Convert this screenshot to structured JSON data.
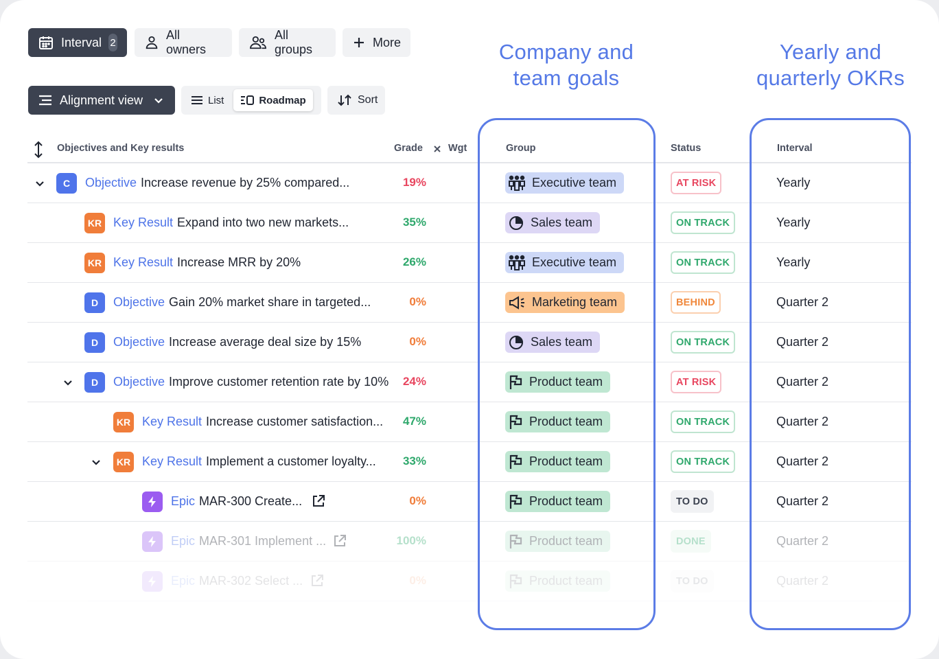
{
  "filters": {
    "interval_label": "Interval",
    "interval_count": "2",
    "owners_label": "All owners",
    "groups_label": "All groups",
    "more_label": "More"
  },
  "view": {
    "alignment_label": "Alignment view",
    "list_label": "List",
    "roadmap_label": "Roadmap",
    "sort_label": "Sort"
  },
  "annotations": {
    "goals": "Company and team goals",
    "okrs": "Yearly and quarterly OKRs"
  },
  "columns": {
    "objectives": "Objectives and Key results",
    "grade": "Grade",
    "weight": "Wgt",
    "group": "Group",
    "status": "Status",
    "interval": "Interval"
  },
  "colors": {
    "accent": "#4d73e8",
    "annotation": "#5579e6",
    "at_risk": "#e8465f",
    "on_track": "#2fa86c",
    "behind": "#f0883c",
    "done": "#2fa86c"
  },
  "rows": [
    {
      "kind": "Objective",
      "tag": "C",
      "title": "Increase revenue by 25% compared...",
      "grade": "19%",
      "group": "Executive team",
      "group_icon": "people-icon",
      "status": "AT RISK",
      "interval": "Yearly"
    },
    {
      "kind": "Key Result",
      "tag": "KR",
      "title": "Expand into two new markets...",
      "grade": "35%",
      "group": "Sales team",
      "group_icon": "pie-chart-icon",
      "status": "ON TRACK",
      "interval": "Yearly"
    },
    {
      "kind": "Key Result",
      "tag": "KR",
      "title": "Increase MRR by 20%",
      "grade": "26%",
      "group": "Executive team",
      "group_icon": "people-icon",
      "status": "ON TRACK",
      "interval": "Yearly"
    },
    {
      "kind": "Objective",
      "tag": "D",
      "title": "Gain 20% market share in targeted...",
      "grade": "0%",
      "group": "Marketing team",
      "group_icon": "megaphone-icon",
      "status": "BEHIND",
      "interval": "Quarter 2"
    },
    {
      "kind": "Objective",
      "tag": "D",
      "title": "Increase average deal size by 15%",
      "grade": "0%",
      "group": "Sales team",
      "group_icon": "pie-chart-icon",
      "status": "ON TRACK",
      "interval": "Quarter 2"
    },
    {
      "kind": "Objective",
      "tag": "D",
      "title": "Improve customer retention rate by 10%",
      "grade": "24%",
      "group": "Product team",
      "group_icon": "flag-icon",
      "status": "AT RISK",
      "interval": "Quarter 2"
    },
    {
      "kind": "Key Result",
      "tag": "KR",
      "title": "Increase customer satisfaction...",
      "grade": "47%",
      "group": "Product team",
      "group_icon": "flag-icon",
      "status": "ON TRACK",
      "interval": "Quarter 2"
    },
    {
      "kind": "Key Result",
      "tag": "KR",
      "title": "Implement a customer loyalty...",
      "grade": "33%",
      "group": "Product team",
      "group_icon": "flag-icon",
      "status": "ON TRACK",
      "interval": "Quarter 2"
    },
    {
      "kind": "Epic",
      "tag": "",
      "tag_icon": "lightning-icon",
      "title": "MAR-300 Create...",
      "grade": "0%",
      "group": "Product team",
      "group_icon": "flag-icon",
      "status": "TO DO",
      "interval": "Quarter 2"
    },
    {
      "kind": "Epic",
      "tag": "",
      "tag_icon": "lightning-icon",
      "title": "MAR-301 Implement ...",
      "grade": "100%",
      "group": "Product team",
      "group_icon": "flag-icon",
      "status": "DONE",
      "interval": "Quarter 2"
    },
    {
      "kind": "Epic",
      "tag": "",
      "tag_icon": "lightning-icon",
      "title": "MAR-302 Select ...",
      "grade": "0%",
      "group": "Product team",
      "group_icon": "flag-icon",
      "status": "TO DO",
      "interval": "Quarter 2"
    }
  ]
}
